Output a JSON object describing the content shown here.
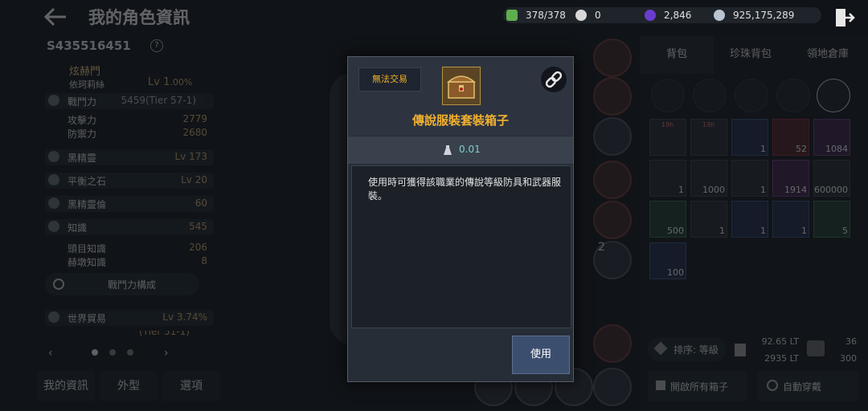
{
  "header": {
    "title": "我的角色資訊",
    "currencies": [
      {
        "icon": "energy-icon",
        "value": "378/378",
        "color": "#5fae4e"
      },
      {
        "icon": "pearl-icon",
        "value": "0",
        "color": "#d8d8d8"
      },
      {
        "icon": "black-gem-icon",
        "value": "2,846",
        "color": "#6a3ccf"
      },
      {
        "icon": "silver-icon",
        "value": "925,175,289",
        "color": "#b8c4d0"
      }
    ]
  },
  "character": {
    "id": "S435516451",
    "family": "炫赫門",
    "server": "依珂莉絲",
    "level": "Lv 1",
    "level_pct": "00%",
    "combat_power_label": "戰鬥力",
    "combat_power": "5459(Tier 57-1)",
    "attack_label": "攻擊力",
    "attack": "2779",
    "defense_label": "防禦力",
    "defense": "2680",
    "black_spirit_label": "黑精靈",
    "black_spirit": "Lv 173",
    "balance_stone_label": "平衡之石",
    "balance_stone": "Lv 20",
    "spirit_weapon_label": "黑精靈倫",
    "spirit_weapon": "60",
    "knowledge_label": "知識",
    "knowledge": "545",
    "head_knowledge_label": "頭目知識",
    "head_knowledge": "206",
    "life_knowledge_label": "赫墩知識",
    "life_knowledge": "8",
    "power_button": "戰鬥力構成",
    "world_trade_label": "世界貿易",
    "world_trade": "Lv 3.74%",
    "partial_row": "(Tier 51-1)"
  },
  "left_tabs": [
    "我的資訊",
    "外型",
    "選項"
  ],
  "inventory": {
    "tabs": [
      "背包",
      "珍珠背包",
      "領地倉庫"
    ],
    "timer_1": "19h",
    "timer_2": "19h",
    "slot_number": "2",
    "items": [
      {
        "count": "",
        "style": "gray",
        "icon": "scroll-icon"
      },
      {
        "count": "",
        "style": "gray",
        "icon": "scroll-icon"
      },
      {
        "count": "1",
        "style": "blue",
        "icon": "chest-icon"
      },
      {
        "count": "52",
        "style": "red",
        "icon": "crystal-icon"
      },
      {
        "count": "1084",
        "style": "purple",
        "icon": "crystal-icon"
      },
      {
        "count": "1",
        "style": "gray",
        "icon": "chest-icon"
      },
      {
        "count": "1000",
        "style": "gray",
        "icon": "chest-icon"
      },
      {
        "count": "1",
        "style": "gray",
        "icon": "chest-icon"
      },
      {
        "count": "1914",
        "style": "purple",
        "icon": "crystal-icon"
      },
      {
        "count": "600000",
        "style": "gray",
        "icon": "stone-icon"
      },
      {
        "count": "500",
        "style": "green",
        "icon": "herb-icon"
      },
      {
        "count": "1",
        "style": "gray",
        "icon": "chest-icon"
      },
      {
        "count": "1",
        "style": "blue",
        "icon": "balloon-icon"
      },
      {
        "count": "1",
        "style": "blue",
        "icon": "animal-icon"
      },
      {
        "count": "5",
        "style": "green",
        "icon": "milk-icon"
      },
      {
        "count": "100",
        "style": "blue",
        "icon": "food-icon"
      }
    ],
    "sort_label": "排序: 等級",
    "weight_current": "92.65 LT",
    "weight_max": "2935 LT",
    "slots_used": "36",
    "slots_max": "300",
    "open_all": "開啟所有箱子",
    "auto_equip": "自動穿戴"
  },
  "modal": {
    "trade_badge": "無法交易",
    "item_name": "傳說服裝套裝箱子",
    "weight": "0.01",
    "description": "使用時可獲得該職業的傳說等級防具和武器服裝。",
    "use_button": "使用"
  },
  "colors": {
    "accent_gold": "#f0b030",
    "weight_teal": "#7fd0c8",
    "value_tan": "#caa36a"
  }
}
